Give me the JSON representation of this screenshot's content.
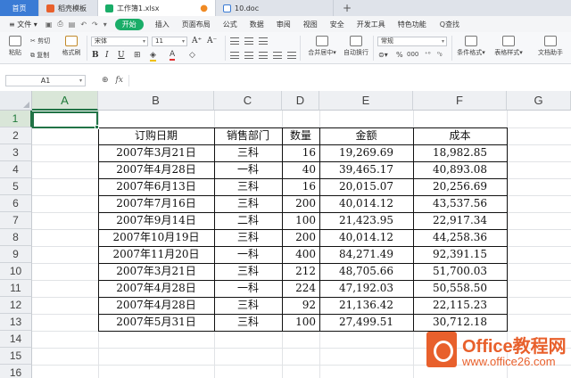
{
  "tabs": {
    "home": "首页",
    "templates": "稻壳模板",
    "workbook": "工作簿1.xlsx",
    "doc": "10.doc",
    "plus": "+"
  },
  "menu": {
    "file": "文件",
    "start": "开始",
    "items": [
      "插入",
      "页面布局",
      "公式",
      "数据",
      "审阅",
      "视图",
      "安全",
      "开发工具",
      "特色功能"
    ],
    "search": "Q查找"
  },
  "ribbon": {
    "paste": "粘贴",
    "cut": "剪切",
    "copy": "复制",
    "format_painter": "格式刷",
    "font_name": "宋体",
    "font_size": "11",
    "grow": "A⁺",
    "shrink": "A⁻",
    "bold": "B",
    "italic": "I",
    "underline": "U",
    "merge_center": "合并居中",
    "wrap_text": "自动换行",
    "number_format": "常规",
    "percent": "%",
    "thousands": "000",
    "cond_format": "条件格式",
    "table_style": "表格样式",
    "doc_helper": "文档助手"
  },
  "formula_bar": {
    "cell_ref": "A1",
    "fx": "fx",
    "value": ""
  },
  "grid": {
    "columns": [
      "A",
      "B",
      "C",
      "D",
      "E",
      "F",
      "G"
    ],
    "rows": [
      "1",
      "2",
      "3",
      "4",
      "5",
      "6",
      "7",
      "8",
      "9",
      "10",
      "11",
      "12",
      "13",
      "14",
      "15",
      "16"
    ],
    "selected_cell": "A1"
  },
  "table": {
    "headers": [
      "订购日期",
      "销售部门",
      "数量",
      "金额",
      "成本"
    ],
    "rows": [
      [
        "2007年3月21日",
        "三科",
        "16",
        "19,269.69",
        "18,982.85"
      ],
      [
        "2007年4月28日",
        "一科",
        "40",
        "39,465.17",
        "40,893.08"
      ],
      [
        "2007年6月13日",
        "三科",
        "16",
        "20,015.07",
        "20,256.69"
      ],
      [
        "2007年7月16日",
        "三科",
        "200",
        "40,014.12",
        "43,537.56"
      ],
      [
        "2007年9月14日",
        "二科",
        "100",
        "21,423.95",
        "22,917.34"
      ],
      [
        "2007年10月19日",
        "三科",
        "200",
        "40,014.12",
        "44,258.36"
      ],
      [
        "2007年11月20日",
        "一科",
        "400",
        "84,271.49",
        "92,391.15"
      ],
      [
        "2007年3月21日",
        "三科",
        "212",
        "48,705.66",
        "51,700.03"
      ],
      [
        "2007年4月28日",
        "一科",
        "224",
        "47,192.03",
        "50,558.50"
      ],
      [
        "2007年4月28日",
        "三科",
        "92",
        "21,136.42",
        "22,115.23"
      ],
      [
        "2007年5月31日",
        "三科",
        "100",
        "27,499.51",
        "30,712.18"
      ]
    ]
  },
  "watermark": {
    "title": "Office教程网",
    "url": "www.office26.com"
  },
  "colors": {
    "accent_green": "#217346",
    "start_tab": "#1aad68",
    "home_tab": "#3a7bd5",
    "watermark": "#e8602c"
  }
}
